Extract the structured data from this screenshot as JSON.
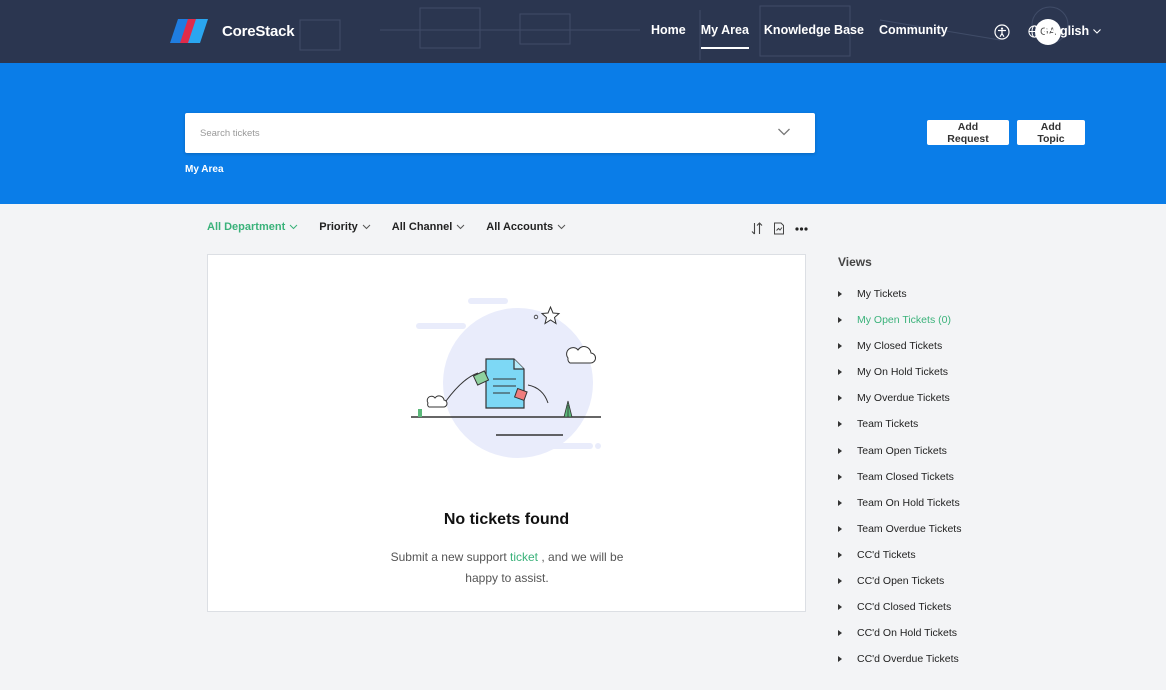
{
  "brand": {
    "name": "CoreStack"
  },
  "nav": {
    "links": [
      {
        "label": "Home",
        "active": false
      },
      {
        "label": "My Area",
        "active": true
      },
      {
        "label": "Knowledge Base",
        "active": false
      },
      {
        "label": "Community",
        "active": false
      }
    ],
    "avatar_initials": "GA",
    "language": "English"
  },
  "hero": {
    "search_placeholder": "Search tickets",
    "breadcrumb": "My Area",
    "add_request_label": "Add Request",
    "add_topic_label": "Add Topic"
  },
  "filters": {
    "department": "All Department",
    "priority": "Priority",
    "channel": "All Channel",
    "accounts": "All Accounts"
  },
  "empty_state": {
    "title": "No tickets found",
    "text_before": "Submit a new support ",
    "link_text": "ticket",
    "text_after": " , and we will be happy to assist."
  },
  "views": {
    "title": "Views",
    "items": [
      {
        "label": "My Tickets",
        "active": false
      },
      {
        "label": "My Open Tickets (0)",
        "active": true
      },
      {
        "label": "My Closed Tickets",
        "active": false
      },
      {
        "label": "My On Hold Tickets",
        "active": false
      },
      {
        "label": "My Overdue Tickets",
        "active": false
      },
      {
        "label": "Team Tickets",
        "active": false
      },
      {
        "label": "Team Open Tickets",
        "active": false
      },
      {
        "label": "Team Closed Tickets",
        "active": false
      },
      {
        "label": "Team On Hold Tickets",
        "active": false
      },
      {
        "label": "Team Overdue Tickets",
        "active": false
      },
      {
        "label": "CC'd Tickets",
        "active": false
      },
      {
        "label": "CC'd Open Tickets",
        "active": false
      },
      {
        "label": "CC'd Closed Tickets",
        "active": false
      },
      {
        "label": "CC'd On Hold Tickets",
        "active": false
      },
      {
        "label": "CC'd Overdue Tickets",
        "active": false
      }
    ]
  },
  "colors": {
    "topbar": "#2b3650",
    "hero_blue": "#0a7de8",
    "accent_green": "#3ab27a",
    "page_bg": "#f3f4f6"
  },
  "icons": {
    "logo": "corestack-logo-icon",
    "accessibility": "accessibility-icon",
    "language": "globe-icon",
    "sort": "sort-icon",
    "export": "export-icon",
    "more": "more-icon",
    "views_item": "caret-right-icon"
  }
}
